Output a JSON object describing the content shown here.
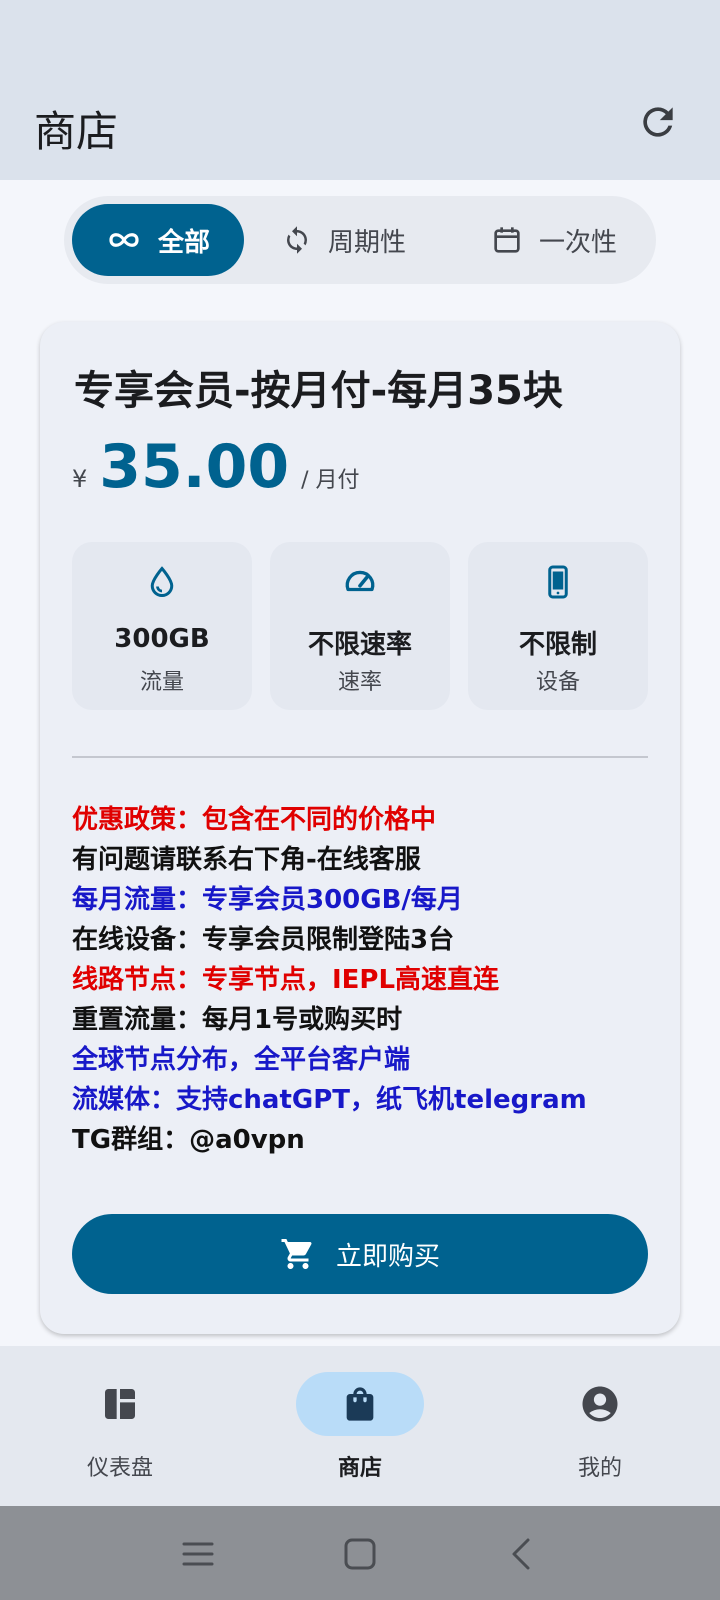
{
  "appbar": {
    "title": "商店",
    "refresh_icon": "refresh-icon"
  },
  "segments": [
    {
      "label": "全部",
      "icon": "infinity-icon",
      "active": true
    },
    {
      "label": "周期性",
      "icon": "sync-icon",
      "active": false
    },
    {
      "label": "一次性",
      "icon": "calendar-icon",
      "active": false
    }
  ],
  "plan": {
    "title": "专享会员-按月付-每月35块",
    "currency": "¥",
    "price": "35.00",
    "period": "/ 月付",
    "stats": [
      {
        "value": "300GB",
        "label": "流量",
        "icon": "droplet-icon"
      },
      {
        "value": "不限速率",
        "label": "速率",
        "icon": "speedometer-icon"
      },
      {
        "value": "不限制",
        "label": "设备",
        "icon": "phone-icon"
      }
    ],
    "description": [
      {
        "text": "优惠政策：包含在不同的价格中",
        "color": "#e00000"
      },
      {
        "text": "有问题请联系右下角-在线客服",
        "color": "#111111"
      },
      {
        "text": "每月流量：专享会员300GB/每月",
        "color": "#1818c8"
      },
      {
        "text": "在线设备：专享会员限制登陆3台",
        "color": "#111111"
      },
      {
        "text": "线路节点：专享节点，IEPL高速直连",
        "color": "#e00000"
      },
      {
        "text": "重置流量：每月1号或购买时",
        "color": "#111111"
      },
      {
        "text": "全球节点分布，全平台客户端",
        "color": "#1818c8"
      },
      {
        "text": "流媒体：支持chatGPT，纸飞机telegram",
        "color": "#1818c8"
      },
      {
        "text": "TG群组：@a0vpn",
        "color": "#111111"
      }
    ],
    "buy_label": "立即购买",
    "buy_icon": "cart-icon"
  },
  "nav": [
    {
      "label": "仪表盘",
      "icon": "dashboard-icon",
      "active": false
    },
    {
      "label": "商店",
      "icon": "shopping-bag-icon",
      "active": true
    },
    {
      "label": "我的",
      "icon": "account-icon",
      "active": false
    }
  ],
  "colors": {
    "primary": "#00628f",
    "appbar": "#dbe2ec",
    "nav_indicator": "#b9dcf8"
  }
}
